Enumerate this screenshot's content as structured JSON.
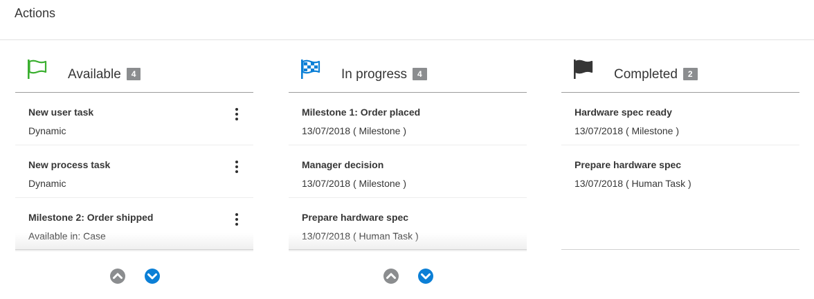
{
  "page": {
    "title": "Actions"
  },
  "colors": {
    "available_flag": "#3aaf2f",
    "in_progress_flag": "#0b7fd6",
    "completed_flag": "#363636",
    "badge": "#8b8d8f",
    "pager_up": "#8b8d8f",
    "pager_down": "#0b7fd6"
  },
  "columns": {
    "available": {
      "title": "Available",
      "count": "4",
      "icon": "outline-flag-icon",
      "cards": [
        {
          "title": "New user task",
          "subtitle": "Dynamic"
        },
        {
          "title": "New process task",
          "subtitle": "Dynamic"
        },
        {
          "title": "Milestone 2: Order shipped",
          "subtitle": "Available in: Case"
        }
      ]
    },
    "in_progress": {
      "title": "In progress",
      "count": "4",
      "icon": "checkered-flag-icon",
      "cards": [
        {
          "title": "Milestone 1: Order placed",
          "subtitle": "13/07/2018 ( Milestone )"
        },
        {
          "title": "Manager decision",
          "subtitle": "13/07/2018 ( Milestone )"
        },
        {
          "title": "Prepare hardware spec",
          "subtitle": "13/07/2018 ( Human Task )"
        }
      ]
    },
    "completed": {
      "title": "Completed",
      "count": "2",
      "icon": "solid-flag-icon",
      "cards": [
        {
          "title": "Hardware spec ready",
          "subtitle": "13/07/2018 ( Milestone )"
        },
        {
          "title": "Prepare hardware spec",
          "subtitle": "13/07/2018 ( Human Task )"
        }
      ]
    }
  }
}
